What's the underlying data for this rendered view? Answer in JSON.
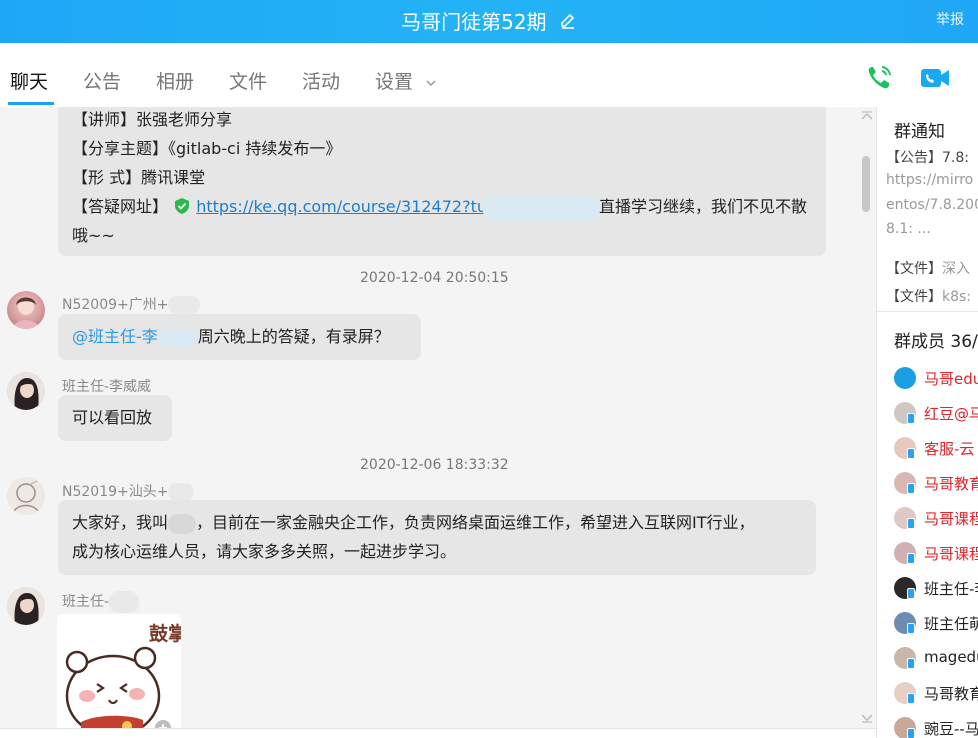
{
  "window": {
    "title": "马哥门徒第52期",
    "report_label": "举报"
  },
  "tabs": [
    {
      "label": "聊天",
      "active": true
    },
    {
      "label": "公告"
    },
    {
      "label": "相册"
    },
    {
      "label": "文件"
    },
    {
      "label": "活动"
    },
    {
      "label": "设置"
    }
  ],
  "colors": {
    "titlebar": "#1fa7f7",
    "accent": "#1aa0f2",
    "call_green": "#19c25a",
    "video_blue": "#1aa8f0",
    "admin_red": "#e0242a"
  },
  "messages": {
    "m1": {
      "lines": [
        "【讲师】张强老师分享",
        "【分享主题】《gitlab-ci 持续发布一》",
        "【形 式】腾讯课堂"
      ],
      "link_prefix": "【答疑网址】",
      "link_text": "https://ke.qq.com/course/312472?tu",
      "link_tail": "直播学习继续，我们不见不散",
      "last_line": "哦~~"
    },
    "ts1": "2020-12-04 20:50:15",
    "m2": {
      "sender": "N52009+广州+",
      "mention": "@班主任-李",
      "text": "周六晚上的答疑，有录屏？"
    },
    "m3": {
      "sender": "班主任-李威威",
      "text": "可以看回放"
    },
    "ts2": "2020-12-06 18:33:32",
    "m4": {
      "sender": "N52019+汕头+",
      "line1_a": "大家好，我叫",
      "line1_b": "，目前在一家金融央企工作，负责网络桌面运维工作，希望进入互联网IT行业，",
      "line2": "成为核心运维人员，请大家多多关照，一起进步学习。"
    },
    "m5": {
      "sender": "班主任-",
      "sticker_text": "鼓掌"
    }
  },
  "sidebar": {
    "notice_title": "群通知",
    "notice_lines": [
      "【公告】7.8:",
      "https://mirro",
      "entos/7.8.200",
      "8.1: ..."
    ],
    "file_lines": [
      {
        "tag": "【文件】",
        "name": "深入"
      },
      {
        "tag": "【文件】",
        "name": "k8s:"
      }
    ],
    "members_title": "群成员 36/",
    "members": [
      {
        "name": "马哥edu",
        "color": "#e0242a"
      },
      {
        "name": "红豆@马",
        "color": "#e0242a"
      },
      {
        "name": "客服-云",
        "color": "#e0242a"
      },
      {
        "name": "马哥教育",
        "color": "#e0242a"
      },
      {
        "name": "马哥课程",
        "color": "#e0242a"
      },
      {
        "name": "马哥课程",
        "color": "#e0242a"
      },
      {
        "name": "班主任-李",
        "color": "#222222"
      },
      {
        "name": "班主任萌",
        "color": "#222222"
      },
      {
        "name": "magedu",
        "color": "#222222"
      },
      {
        "name": "马哥教育",
        "color": "#222222"
      },
      {
        "name": "豌豆--马",
        "color": "#222222"
      }
    ]
  }
}
